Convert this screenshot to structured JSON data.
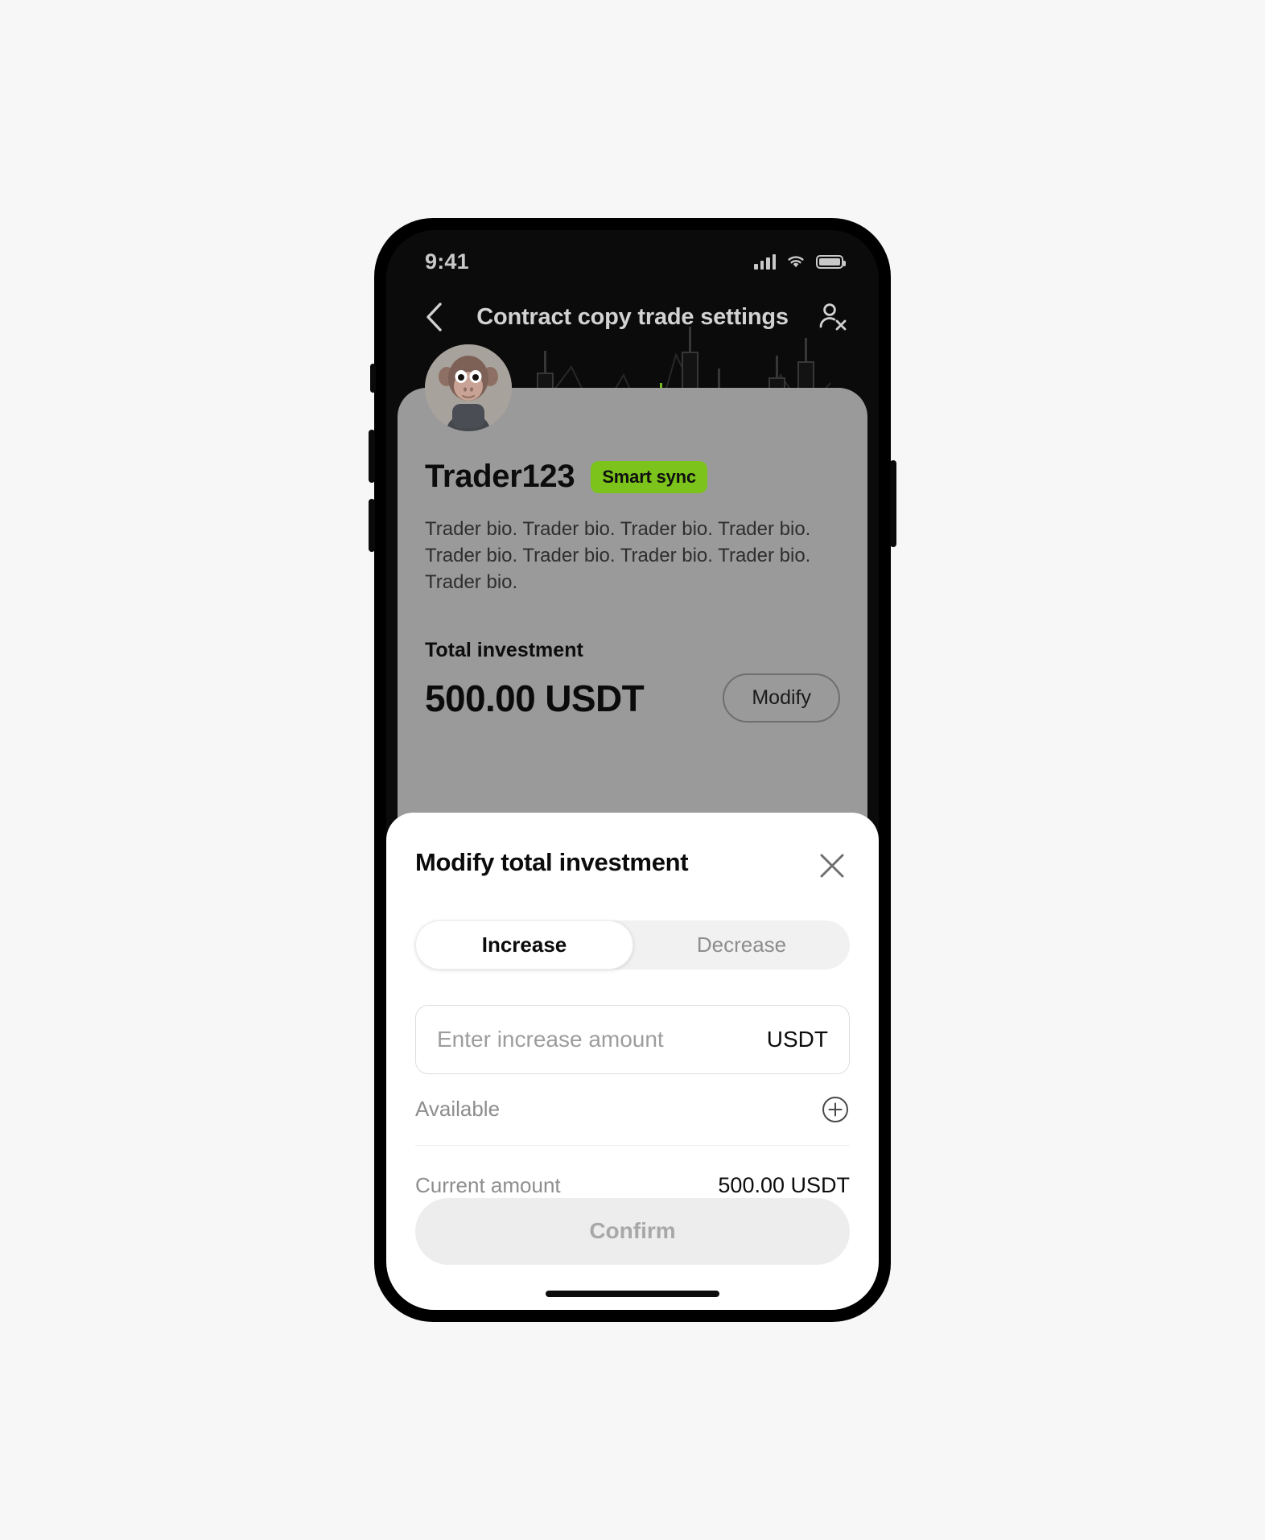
{
  "status_bar": {
    "time": "9:41",
    "signal_icon": "cellular-signal-icon",
    "wifi_icon": "wifi-icon",
    "battery_icon": "battery-full-icon"
  },
  "nav": {
    "back_icon": "chevron-left-icon",
    "title": "Contract copy trade settings",
    "user_icon": "person-remove-icon"
  },
  "trader": {
    "avatar_alt": "trader-avatar",
    "name": "Trader123",
    "badge": "Smart sync",
    "badge_color": "#7cc31c",
    "bio": "Trader bio. Trader bio. Trader bio. Trader bio. Trader bio. Trader bio. Trader bio. Trader bio. Trader bio.",
    "investment_label": "Total investment",
    "investment_amount": "500.00 USDT",
    "modify_button": "Modify"
  },
  "sheet": {
    "title": "Modify total investment",
    "close_icon": "close-icon",
    "tabs": [
      {
        "label": "Increase",
        "active": true
      },
      {
        "label": "Decrease",
        "active": false
      }
    ],
    "input": {
      "value": "",
      "placeholder": "Enter increase amount",
      "suffix": "USDT"
    },
    "available": {
      "label": "Available",
      "value": "",
      "add_icon": "plus-circle-icon"
    },
    "current": {
      "label": "Current amount",
      "value": "500.00 USDT"
    },
    "confirm_button": "Confirm",
    "confirm_disabled": true
  }
}
